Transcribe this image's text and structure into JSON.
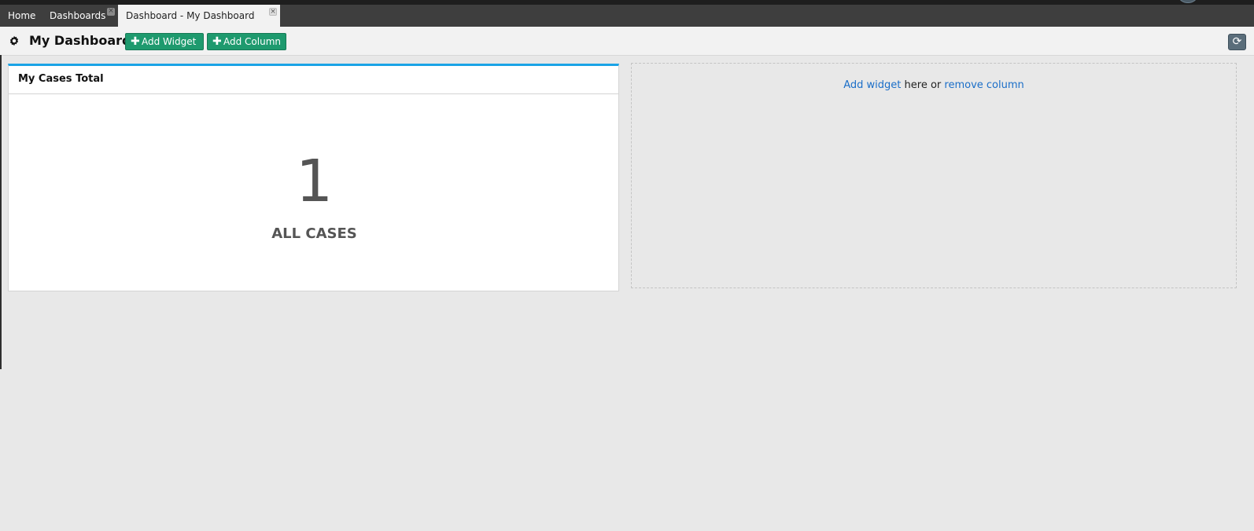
{
  "tabs": [
    {
      "label": "Home"
    },
    {
      "label": "Dashboards",
      "closable": true
    },
    {
      "label": "Dashboard - My Dashboard",
      "closable": true,
      "active": true
    }
  ],
  "toolbar": {
    "title": "My Dashboard",
    "add_widget_label": "Add Widget",
    "add_column_label": "Add Column",
    "plus_glyph": "✚",
    "refresh_glyph": "⟳"
  },
  "widget": {
    "title": "My Cases Total",
    "value": "1",
    "caption": "ALL CASES"
  },
  "empty_column": {
    "add_widget_link": "Add widget",
    "middle_text": " here or ",
    "remove_column_link": "remove column"
  },
  "colors": {
    "accent_green": "#1e9a6e",
    "widget_top_border": "#1aa3e6",
    "link_blue": "#1a6ec8",
    "tab_bar_bg": "#3e3e3e"
  },
  "icons": {
    "gear": "gear-icon",
    "refresh": "refresh-icon",
    "close": "close-icon",
    "plus": "plus-icon"
  }
}
